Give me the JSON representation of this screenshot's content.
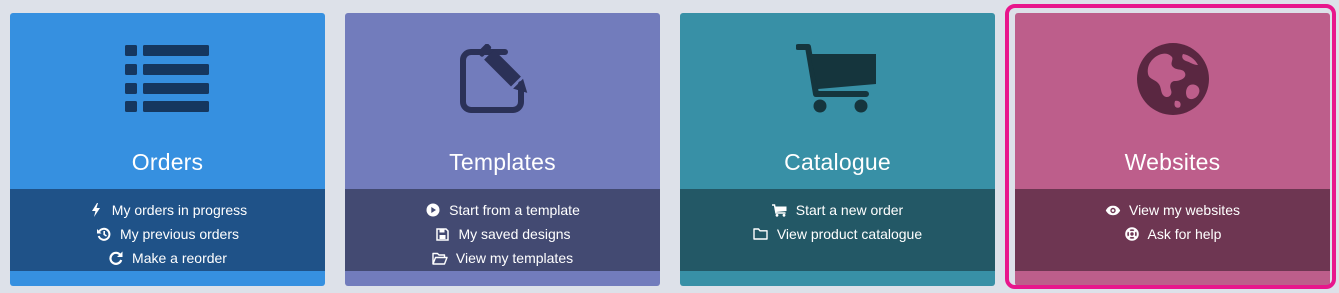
{
  "cards": [
    {
      "title": "Orders",
      "icon": "list-icon",
      "color": "#3690e0",
      "links": [
        {
          "label": "My orders in progress",
          "icon": "bolt-icon"
        },
        {
          "label": "My previous orders",
          "icon": "history-icon"
        },
        {
          "label": "Make a reorder",
          "icon": "refresh-icon"
        }
      ]
    },
    {
      "title": "Templates",
      "icon": "edit-icon",
      "color": "#727cbc",
      "links": [
        {
          "label": "Start from a template",
          "icon": "play-circle-icon"
        },
        {
          "label": "My saved designs",
          "icon": "floppy-disk-icon"
        },
        {
          "label": "View my templates",
          "icon": "folder-open-icon"
        }
      ]
    },
    {
      "title": "Catalogue",
      "icon": "shopping-cart-icon",
      "color": "#3890a6",
      "links": [
        {
          "label": "Start a new order",
          "icon": "cart-icon"
        },
        {
          "label": "View product catalogue",
          "icon": "folder-icon"
        }
      ]
    },
    {
      "title": "Websites",
      "icon": "globe-icon",
      "color": "#bd5e8b",
      "selected": true,
      "links": [
        {
          "label": "View my websites",
          "icon": "eye-icon"
        },
        {
          "label": "Ask for help",
          "icon": "life-ring-icon"
        }
      ]
    }
  ],
  "selection_outline_color": "#e8168c"
}
